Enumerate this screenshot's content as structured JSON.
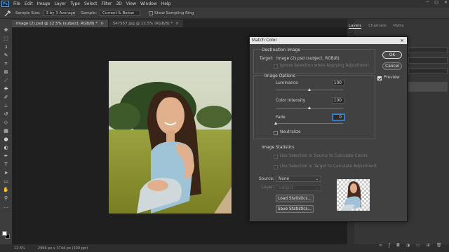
{
  "menu": {
    "logo": "Ps",
    "items": [
      "File",
      "Edit",
      "Image",
      "Layer",
      "Type",
      "Select",
      "Filter",
      "3D",
      "View",
      "Window",
      "Help"
    ]
  },
  "options_bar": {
    "sample_size_label": "Sample Size:",
    "sample_size_value": "3 by 3 Average",
    "sample_label": "Sample:",
    "sample_value": "Current & Below",
    "sampling_ring_label": "Show Sampling Ring"
  },
  "doc_tabs": [
    {
      "label": "Image (2).psd @ 12.5% (subject, RGB/8) *",
      "active": true
    },
    {
      "label": "547557.jpg @ 12.5% (RGB/8) *",
      "active": false
    }
  ],
  "status": {
    "zoom": "12.5%",
    "doc_size": "2996 px x 3744 px (300 ppi)"
  },
  "right_panel": {
    "tabs": [
      "Layers",
      "Channels",
      "Paths"
    ],
    "active_tab": "Layers"
  },
  "dialog": {
    "title": "Match Color",
    "close": "×",
    "destination": {
      "heading": "Destination Image",
      "target_label": "Target:",
      "target_value": "Image (2).psd (subject, RGB/8)",
      "ignore_selection": "Ignore Selection when Applying Adjustment"
    },
    "image_options": {
      "heading": "Image Options",
      "luminance_label": "Luminance",
      "luminance_value": "100",
      "luminance_level": 0.5,
      "color_intensity_label": "Color Intensity",
      "color_intensity_value": "100",
      "color_intensity_level": 0.5,
      "fade_label": "Fade",
      "fade_value": "0",
      "fade_level": 0,
      "neutralize_label": "Neutralize"
    },
    "image_statistics": {
      "heading": "Image Statistics",
      "use_source": "Use Selection in Source to Calculate Colors",
      "use_target": "Use Selection in Target to Calculate Adjustment",
      "source_label": "Source:",
      "source_value": "None",
      "layer_label": "Layer:",
      "layer_value": "subject",
      "load_button": "Load Statistics...",
      "save_button": "Save Statistics..."
    },
    "ok_button": "OK",
    "cancel_button": "Cancel",
    "preview_label": "Preview",
    "preview_checked": true
  }
}
